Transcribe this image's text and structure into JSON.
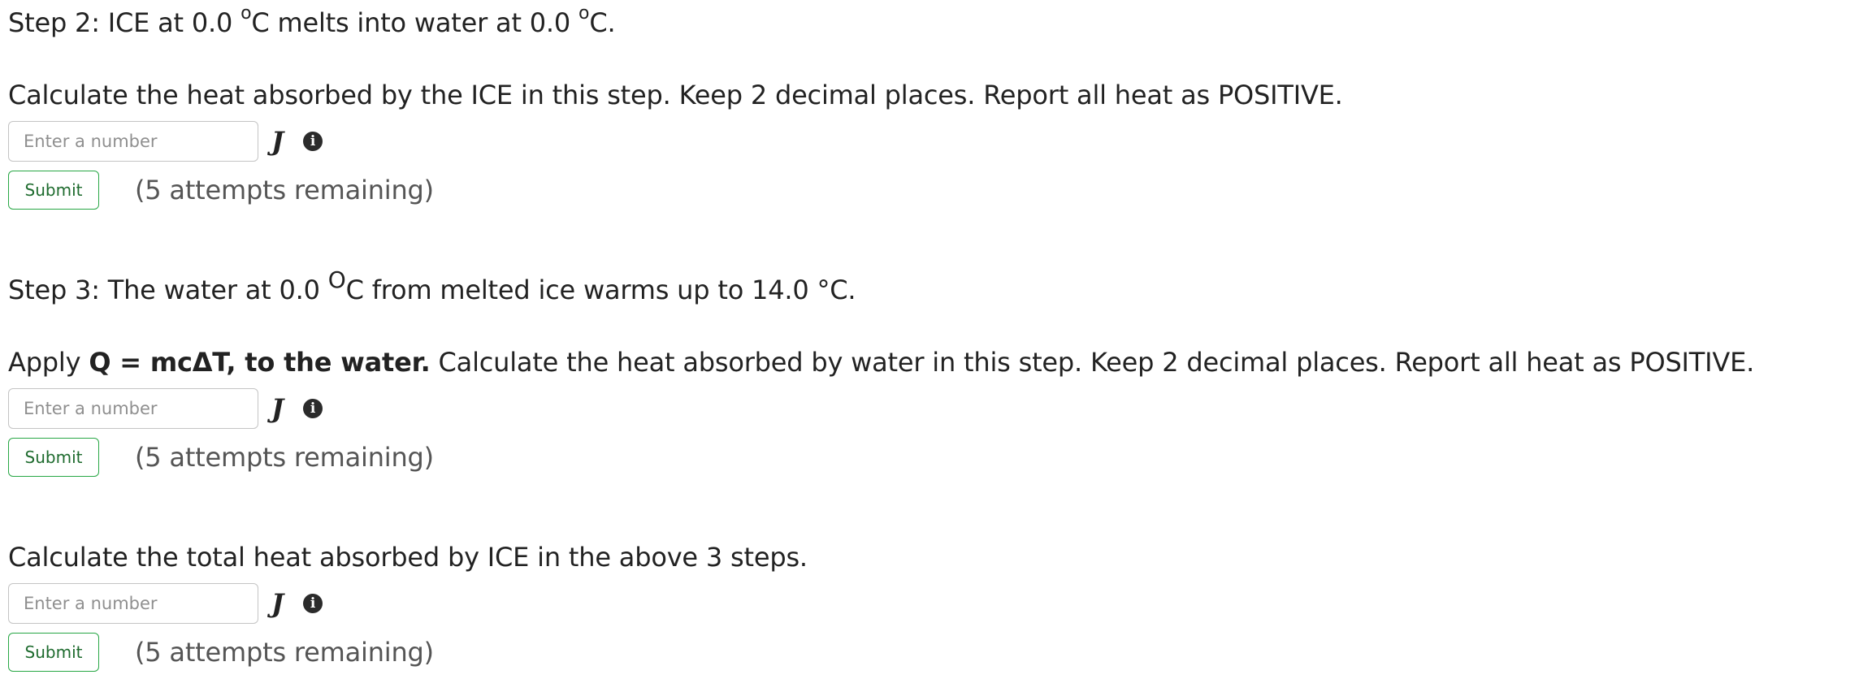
{
  "step2": {
    "title_prefix": "Step 2: ICE at 0.0 ",
    "title_deg1": "o",
    "title_mid": "C melts into water at 0.0 ",
    "title_deg2": "o",
    "title_suffix": "C.",
    "instruction": "Calculate the heat absorbed by the ICE in this step.  Keep 2 decimal places. Report all heat as POSITIVE.",
    "input_placeholder": "Enter a number",
    "unit": "J",
    "info_icon": "i",
    "submit_label": "Submit",
    "attempts": "(5 attempts remaining)"
  },
  "step3": {
    "title_prefix": "Step 3: The water at 0.0 ",
    "title_deg": "O",
    "title_suffix": "C from melted ice warms up to 14.0 °C.",
    "instruction_prefix": "Apply  ",
    "instruction_bold": "Q = mcΔT, to the water.",
    "instruction_suffix": " Calculate the heat absorbed by water in this step.  Keep 2 decimal places. Report all heat as POSITIVE.",
    "input_placeholder": "Enter a number",
    "unit": "J",
    "info_icon": "i",
    "submit_label": "Submit",
    "attempts": "(5 attempts remaining)"
  },
  "total": {
    "instruction": "Calculate the total heat absorbed by ICE in the above 3 steps.",
    "input_placeholder": "Enter a number",
    "unit": "J",
    "info_icon": "i",
    "submit_label": "Submit",
    "attempts": "(5 attempts remaining)"
  }
}
